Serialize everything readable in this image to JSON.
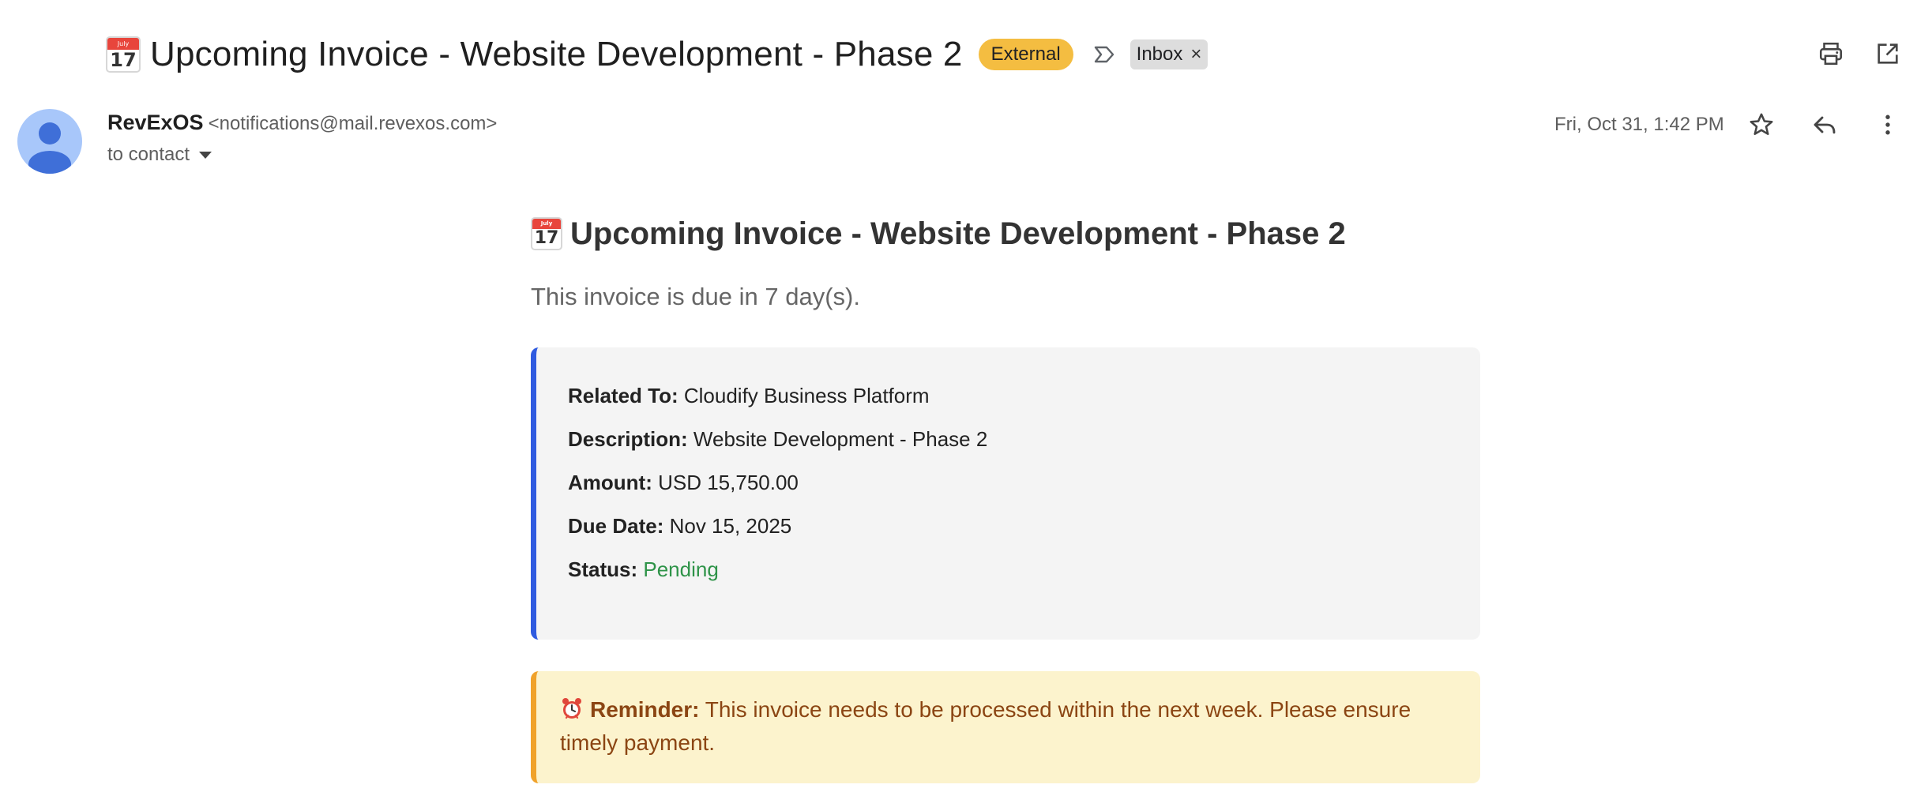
{
  "subject": {
    "emoji_icon": "calendar-icon",
    "calendar_month": "July",
    "calendar_day": "17",
    "title": "Upcoming Invoice - Website Development - Phase 2",
    "badge": "External",
    "label_chip": "Inbox",
    "label_chip_remove": "×"
  },
  "sender": {
    "name": "RevExOS",
    "email": "<notifications@mail.revexos.com>",
    "to_line": "to contact",
    "date": "Fri, Oct 31, 1:42 PM"
  },
  "body": {
    "heading": "Upcoming Invoice - Website Development - Phase 2",
    "intro": "This invoice is due in 7 day(s).",
    "details": [
      {
        "label": "Related To:",
        "value": "Cloudify Business Platform"
      },
      {
        "label": "Description:",
        "value": "Website Development - Phase 2"
      },
      {
        "label": "Amount:",
        "value": "USD 15,750.00"
      },
      {
        "label": "Due Date:",
        "value": "Nov 15, 2025"
      },
      {
        "label": "Status:",
        "value": "Pending"
      }
    ],
    "reminder_label": "Reminder:",
    "reminder_text": "This invoice needs to be processed within the next week. Please ensure timely payment."
  },
  "colors": {
    "external_badge": "#f4bd41",
    "details_accent": "#2f5be0",
    "status_pending": "#2e9348",
    "reminder_bg": "#fcf3cd",
    "reminder_accent": "#f0a22b",
    "reminder_text": "#8b4513",
    "avatar_bg": "#a8c7fa"
  },
  "icons": [
    "print-icon",
    "open-in-new-window-icon",
    "star-icon",
    "reply-icon",
    "more-vert-icon",
    "label-arrow-icon",
    "alarm-clock-icon"
  ]
}
